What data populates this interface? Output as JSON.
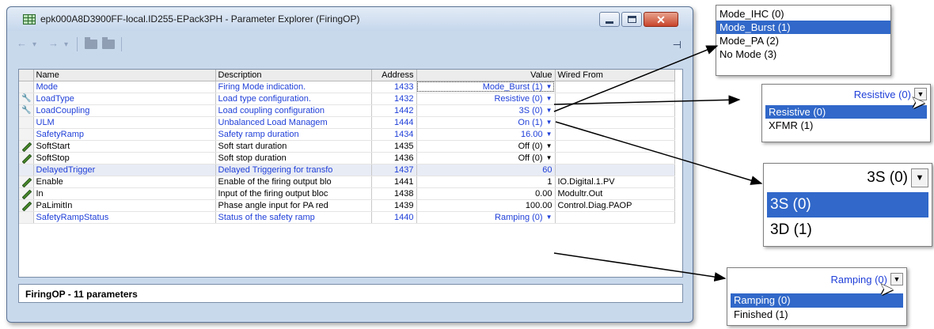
{
  "window": {
    "title": "epk000A8D3900FF-local.ID255-EPack3PH - Parameter Explorer (FiringOP)",
    "controls": {
      "minimize": "minimize",
      "maximize": "maximize",
      "close": "✕"
    }
  },
  "toolbar": {
    "back_icon": "←",
    "dropdown_icon": "▾",
    "forward_icon": "→",
    "pin_icon": "⊣"
  },
  "table": {
    "headers": {
      "name": "Name",
      "description": "Description",
      "address": "Address",
      "value": "Value",
      "wired_from": "Wired From"
    },
    "rows": [
      {
        "icon": "",
        "name": "Mode",
        "description": "Firing Mode indication.",
        "address": "1433",
        "value": "Mode_Burst (1)",
        "wired_from": ""
      },
      {
        "icon": "wrench",
        "name": "LoadType",
        "description": "Load type configuration.",
        "address": "1432",
        "value": "Resistive (0)",
        "wired_from": ""
      },
      {
        "icon": "wrench",
        "name": "LoadCoupling",
        "description": "Load coupling configuration",
        "address": "1442",
        "value": "3S (0)",
        "wired_from": ""
      },
      {
        "icon": "",
        "name": "ULM",
        "description": "Unbalanced Load Managem",
        "address": "1444",
        "value": "On (1)",
        "wired_from": ""
      },
      {
        "icon": "",
        "name": "SafetyRamp",
        "description": "Safety ramp duration",
        "address": "1434",
        "value": "16.00",
        "wired_from": ""
      },
      {
        "icon": "pencil",
        "name": "SoftStart",
        "description": "Soft start duration",
        "address": "1435",
        "value": "Off (0)",
        "wired_from": ""
      },
      {
        "icon": "pencil",
        "name": "SoftStop",
        "description": "Soft stop duration",
        "address": "1436",
        "value": "Off (0)",
        "wired_from": ""
      },
      {
        "icon": "",
        "name": "DelayedTrigger",
        "description": "Delayed Triggering for transfo",
        "address": "1437",
        "value": "60",
        "wired_from": ""
      },
      {
        "icon": "pencil",
        "name": "Enable",
        "description": "Enable of the firing output blo",
        "address": "1441",
        "value": "1",
        "wired_from": "IO.Digital.1.PV"
      },
      {
        "icon": "pencil",
        "name": "In",
        "description": "Input of the firing output bloc",
        "address": "1438",
        "value": "0.00",
        "wired_from": "Modultr.Out"
      },
      {
        "icon": "pencil",
        "name": "PaLimitIn",
        "description": "Phase angle input for PA red",
        "address": "1439",
        "value": "100.00",
        "wired_from": "Control.Diag.PAOP"
      },
      {
        "icon": "",
        "name": "SafetyRampStatus",
        "description": "Status of the safety ramp",
        "address": "1440",
        "value": "Ramping (0)",
        "wired_from": ""
      }
    ]
  },
  "status_bar": {
    "text": "FiringOP  -  11 parameters"
  },
  "popups": {
    "mode": {
      "options": [
        "Mode_IHC (0)",
        "Mode_Burst (1)",
        "Mode_PA (2)",
        "No Mode (3)"
      ],
      "selected": 1
    },
    "loadtype": {
      "current": "Resistive (0)",
      "options": [
        "Resistive (0)",
        "XFMR (1)"
      ],
      "selected": 0
    },
    "loadcoupling": {
      "current": "3S (0)",
      "options": [
        "3S (0)",
        "3D (1)"
      ],
      "selected": 0
    },
    "ramp": {
      "current": "Ramping (0)",
      "options": [
        "Ramping (0)",
        "Finished (1)"
      ],
      "selected": 0
    }
  },
  "colors": {
    "link_blue": "#1f3fd8",
    "selection": "#3168c9",
    "titlebar": "#c9d9ec",
    "close_button": "#c8452c"
  },
  "icons": {
    "wrench": "wrench-icon",
    "pencil": "pencil-icon",
    "cursor": "cursor-icon",
    "app": "grid-icon"
  }
}
